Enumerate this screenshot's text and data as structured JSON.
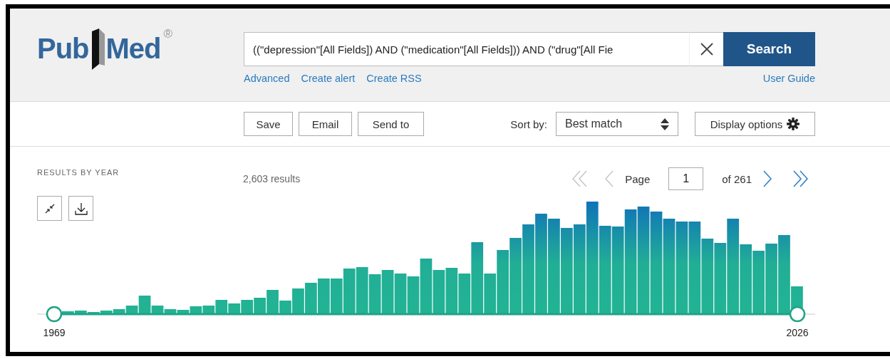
{
  "logo": {
    "left_text": "Pub",
    "right_text": "Med",
    "mark": "®"
  },
  "search": {
    "query": "((\"depression\"[All Fields]) AND (\"medication\"[All Fields])) AND (\"drug\"[All Fie",
    "button": "Search"
  },
  "search_links": [
    {
      "label": "Advanced"
    },
    {
      "label": "Create alert"
    },
    {
      "label": "Create RSS"
    }
  ],
  "user_guide": "User Guide",
  "actions": [
    {
      "label": "Save"
    },
    {
      "label": "Email"
    },
    {
      "label": "Send to"
    }
  ],
  "sort": {
    "label": "Sort by:",
    "value": "Best match"
  },
  "display_options": "Display options",
  "timeline": {
    "title": "RESULTS BY YEAR",
    "range_start": "1969",
    "range_end": "2026"
  },
  "results_count": "2,603 results",
  "pagination": {
    "first": {
      "disabled": true
    },
    "previous": {
      "disabled": true
    },
    "label": "Page",
    "current": "1",
    "total": "of 261",
    "next": {
      "disabled": false
    },
    "last": {
      "disabled": false
    }
  }
}
